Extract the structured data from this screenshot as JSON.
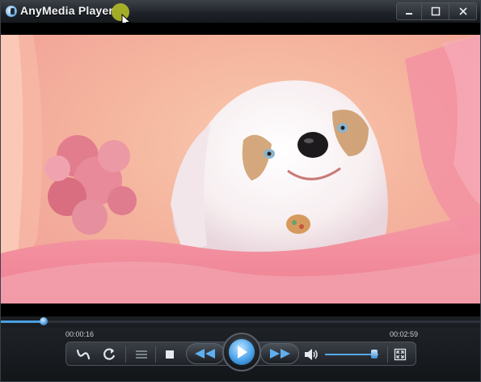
{
  "window": {
    "title": "AnyMedia Player"
  },
  "icons": {
    "app": "app-logo-icon",
    "minimize": "minimize-icon",
    "maximize": "maximize-icon",
    "close": "close-icon",
    "repeat": "repeat-icon",
    "shuffle": "shuffle-icon",
    "playlist": "playlist-icon",
    "stop": "stop-icon",
    "rewind": "rewind-icon",
    "play": "play-icon",
    "forward": "fast-forward-icon",
    "volume": "speaker-icon",
    "fullscreen": "fullscreen-icon"
  },
  "playback": {
    "elapsed": "00:00:16",
    "duration": "00:02:59",
    "progress_fraction": 0.09,
    "volume_fraction": 0.92
  },
  "colors": {
    "accent": "#4a9fe0",
    "background": "#101317"
  }
}
